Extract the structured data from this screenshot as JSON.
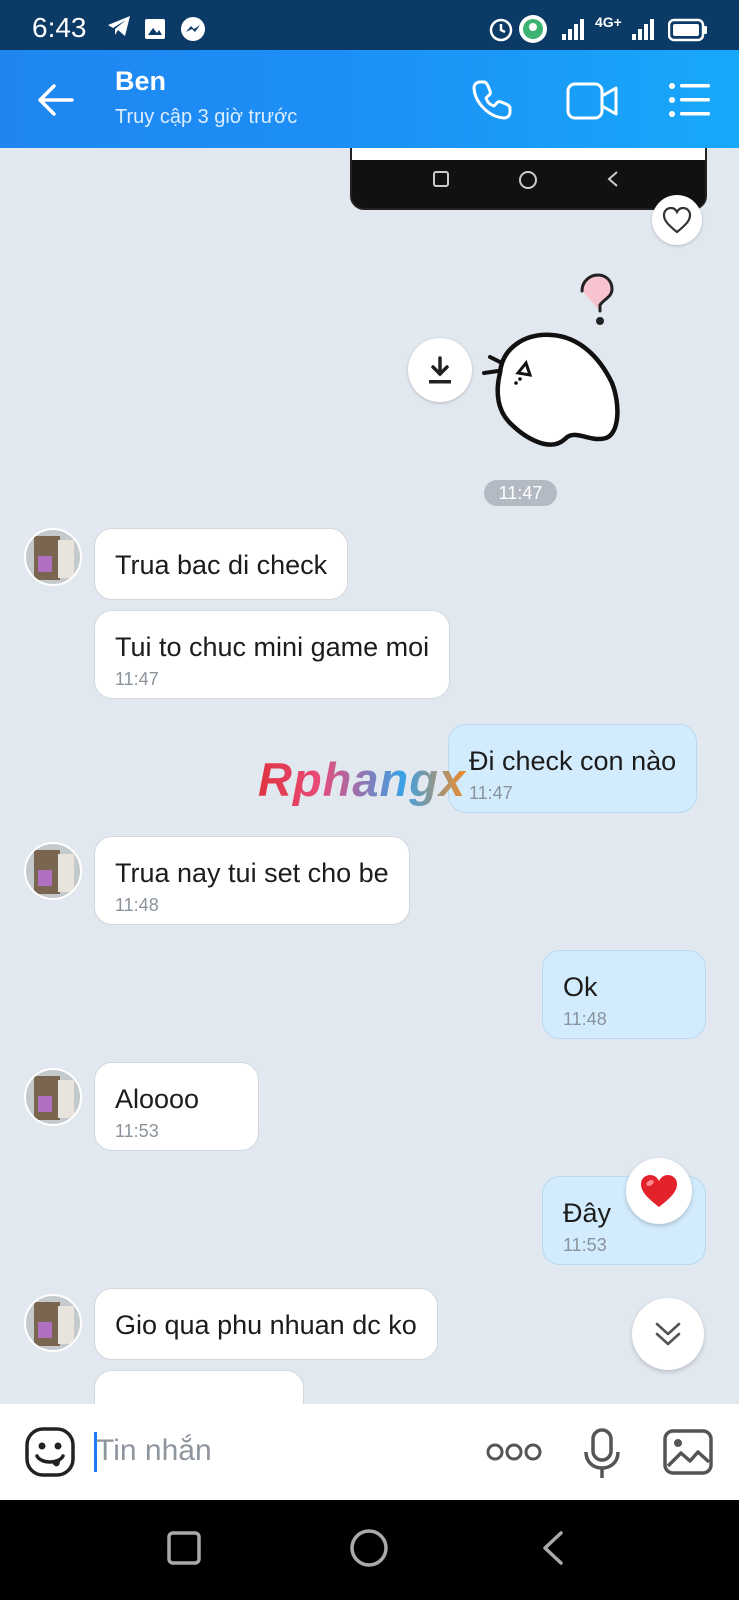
{
  "status_bar": {
    "time": "6:43",
    "network_label": "4G+"
  },
  "header": {
    "contact_name": "Ben",
    "status": "Truy cập 3 giờ trước"
  },
  "messages": [
    {
      "from": "contact",
      "text": "Trua bac di check"
    },
    {
      "from": "contact",
      "text": "Tui to chuc mini game moi",
      "time": "11:47"
    },
    {
      "from": "me",
      "text": "Đi check con nào",
      "time": "11:47"
    },
    {
      "from": "contact",
      "text": "Trua nay tui set cho be",
      "time": "11:48"
    },
    {
      "from": "me",
      "text": "Ok",
      "time": "11:48"
    },
    {
      "from": "contact",
      "text": "Aloooo",
      "time": "11:53"
    },
    {
      "from": "me",
      "text": "Đây",
      "time": "11:53"
    },
    {
      "from": "contact",
      "text": "Gio qua phu nhuan dc ko"
    }
  ],
  "sticker_time": "11:47",
  "watermark": "Rphangx",
  "input": {
    "placeholder": "Tin nhắn"
  },
  "colors": {
    "header_start": "#1f86f0",
    "header_end": "#17a8fa",
    "outgoing_bubble": "#d3ecfd",
    "incoming_bubble": "#ffffff",
    "chat_bg": "#e2e8f0"
  },
  "icons": [
    "back-arrow-icon",
    "phone-icon",
    "video-call-icon",
    "menu-list-icon",
    "heart-outline-icon",
    "download-icon",
    "question-mark-icon",
    "heart-reaction-icon",
    "double-chevron-down-icon",
    "emoji-icon",
    "more-dots-icon",
    "microphone-icon",
    "image-icon"
  ]
}
